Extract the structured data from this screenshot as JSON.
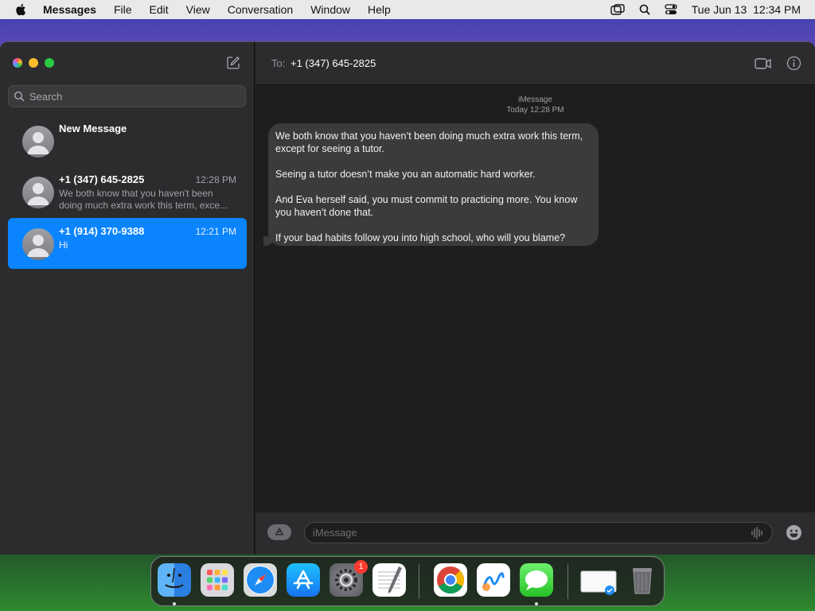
{
  "menubar": {
    "app_name": "Messages",
    "menus": [
      "File",
      "Edit",
      "View",
      "Conversation",
      "Window",
      "Help"
    ],
    "datetime": "Tue Jun 13  12:34 PM",
    "status_icons": [
      "display-icon",
      "spotlight-search-icon",
      "control-center-icon"
    ]
  },
  "sidebar": {
    "search_placeholder": "Search",
    "conversations": [
      {
        "name": "New Message",
        "time": "",
        "preview": "",
        "selected": false
      },
      {
        "name": "+1 (347) 645-2825",
        "time": "12:28 PM",
        "preview": "We both know that you haven't been doing much extra work this term, exce...",
        "selected": false
      },
      {
        "name": "+1 (914) 370-9388",
        "time": "12:21 PM",
        "preview": "Hi",
        "selected": true
      }
    ]
  },
  "chat": {
    "to_label": "To:",
    "recipient": "+1 (347) 645-2825",
    "service": "iMessage",
    "timestamp": "Today 12:28 PM",
    "messages": [
      {
        "paragraphs": [
          "We both know that you haven’t been doing much extra work this term, except for seeing a tutor.",
          "Seeing a tutor doesn’t make you an automatic hard worker.",
          "And Eva herself said, you must commit to practicing more.  You know you haven’t done that.",
          "If your bad habits follow you into high school, who will you blame?"
        ]
      }
    ],
    "input_placeholder": "iMessage",
    "input_value": ""
  },
  "dock": {
    "apps": [
      "Finder",
      "Launchpad",
      "Safari",
      "App Store",
      "System Settings",
      "TextEdit",
      "Google Chrome",
      "Freeform",
      "Messages",
      "Preview",
      "Trash"
    ],
    "settings_badge": "1"
  },
  "colors": {
    "selection": "#0a84ff",
    "bubble": "#3b3b3d",
    "sidebar": "#2c2c2e",
    "chat_bg": "#1e1e1e"
  }
}
